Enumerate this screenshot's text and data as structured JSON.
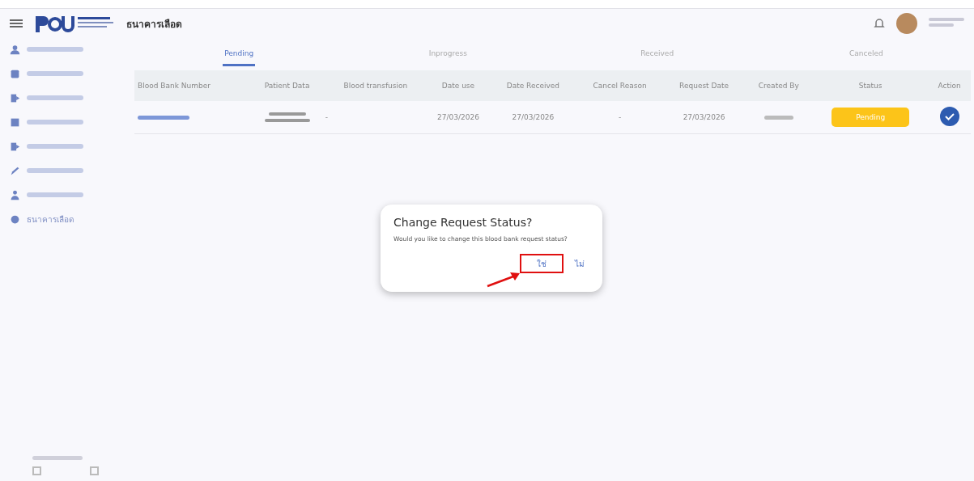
{
  "header": {
    "title": "ธนาคารเลือด"
  },
  "sidebar": {
    "items": [
      {
        "selected": false
      },
      {
        "selected": false
      },
      {
        "selected": false
      },
      {
        "selected": false
      },
      {
        "selected": false
      },
      {
        "selected": false
      },
      {
        "selected": false
      },
      {
        "label": "ธนาคารเลือด",
        "selected": false
      }
    ]
  },
  "tabs": [
    {
      "label": "Pending",
      "selected": true
    },
    {
      "label": "Inprogress",
      "selected": false
    },
    {
      "label": "Received",
      "selected": false
    },
    {
      "label": "Canceled",
      "selected": false
    }
  ],
  "table": {
    "columns": [
      "Blood Bank Number",
      "Patient Data",
      "Blood transfusion",
      "Date use",
      "Date Received",
      "Cancel Reason",
      "Request Date",
      "Created By",
      "Status",
      "Action"
    ],
    "rows": [
      {
        "blood_transfusion": "-",
        "date_use": "27/03/2026",
        "date_received": "27/03/2026",
        "cancel_reason": "-",
        "request_date": "27/03/2026",
        "status": "Pending"
      }
    ]
  },
  "dialog": {
    "title": "Change Request Status?",
    "message": "Would you like to change this blood bank request status?",
    "buttons": [
      {
        "label": "ใช่",
        "highlighted": true
      },
      {
        "label": "ไม่",
        "highlighted": false
      }
    ]
  }
}
